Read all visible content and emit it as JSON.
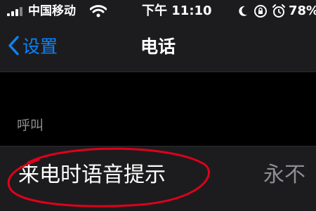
{
  "status_bar": {
    "carrier": "中国移动",
    "time": "下午 11:10",
    "battery_percent": "78%",
    "icons": [
      "signal-icon",
      "wifi-icon",
      "moon-icon",
      "orientation-lock-icon",
      "alarm-icon"
    ]
  },
  "nav": {
    "back_label": "设置",
    "title": "电话"
  },
  "section": {
    "header": "呼叫"
  },
  "cell": {
    "label": "来电时语音提示",
    "value": "永不"
  },
  "colors": {
    "accent": "#0a84ff",
    "annotation": "#e0001b",
    "background": "#000000",
    "surface": "#1c1c1e",
    "secondary_text": "#8e8e93"
  }
}
